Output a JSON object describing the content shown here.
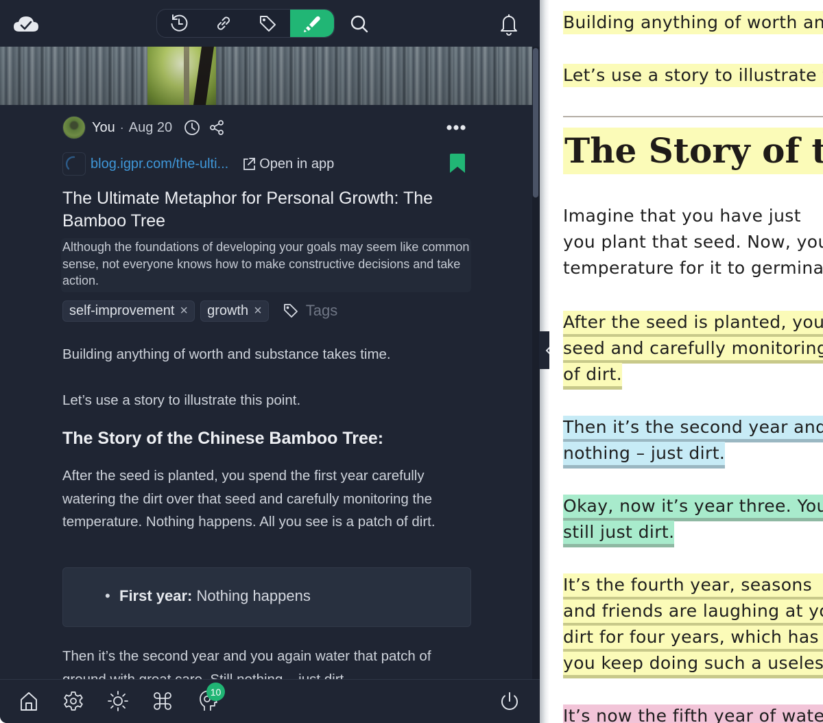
{
  "toolbar": {
    "sync_status_icon": "cloud-check-icon",
    "tools": [
      {
        "name": "history",
        "icon": "history-icon",
        "active": false
      },
      {
        "name": "links",
        "icon": "link-icon",
        "active": false
      },
      {
        "name": "tags",
        "icon": "tag-icon",
        "active": false
      },
      {
        "name": "highlights",
        "icon": "highlighter-icon",
        "active": true
      }
    ],
    "search_icon": "search-icon",
    "notifications_icon": "bell-icon"
  },
  "colors": {
    "accent": "#21b675",
    "panel_bg": "#1f2533",
    "link": "#3f97d8",
    "highlight_yellow": "#fbfbb8",
    "highlight_blue": "#c7ebf6",
    "highlight_green": "#a8ebcc",
    "highlight_pink": "#f2c4d8"
  },
  "article": {
    "author": "You",
    "separator": "·",
    "date": "Aug 20",
    "url": "blog.igpr.com/the-ulti...",
    "open_in_app": "Open in app",
    "title": "The Ultimate Metaphor for Personal Growth: The Bamboo Tree",
    "summary": "Although the foundations of developing your goals may seem like common sense, not everyone knows how to make constructive decisions and take action.",
    "tags": [
      "self-improvement",
      "growth"
    ],
    "tag_remove": "×",
    "add_tags_placeholder": "Tags",
    "bookmarked": true
  },
  "body": {
    "p1": "Building anything of worth and substance takes time.",
    "p2": "Let’s use a story to illustrate this point.",
    "heading": "The Story of the Chinese Bamboo Tree:",
    "p3": "After the seed is planted, you spend the first year carefully watering the dirt over that seed and carefully monitoring the temperature. Nothing happens. All you see is a patch of dirt.",
    "callout_bold": "First year:",
    "callout_text": " Nothing happens",
    "p4": "Then it’s the second year and you again water that patch of ground with great care. Still nothing – just dirt."
  },
  "bottom_bar": {
    "items": [
      "home-icon",
      "settings-icon",
      "theme-icon",
      "shortcuts-icon",
      "tips-icon"
    ],
    "tips_badge": "10",
    "power_icon": "power-icon"
  },
  "reader": {
    "lines": [
      "Building anything of worth and substance takes time.",
      "Let’s use a story to illustrate this point.",
      "The Story of the Chinese Bamboo Tree",
      " Imagine that you have just",
      "you plant that seed. Now, you",
      "temperature for it to germinate",
      "After the seed is planted, you",
      "seed and carefully monitoring",
      "of dirt.",
      "Then it’s the second year and",
      "nothing – just dirt.",
      "Okay, now it’s year three. You",
      "still just dirt.",
      "It’s the fourth year, seasons",
      "and friends are laughing at you",
      "dirt for four years, which has",
      "you keep doing such a useless",
      "It’s now the fifth year of watering"
    ]
  }
}
